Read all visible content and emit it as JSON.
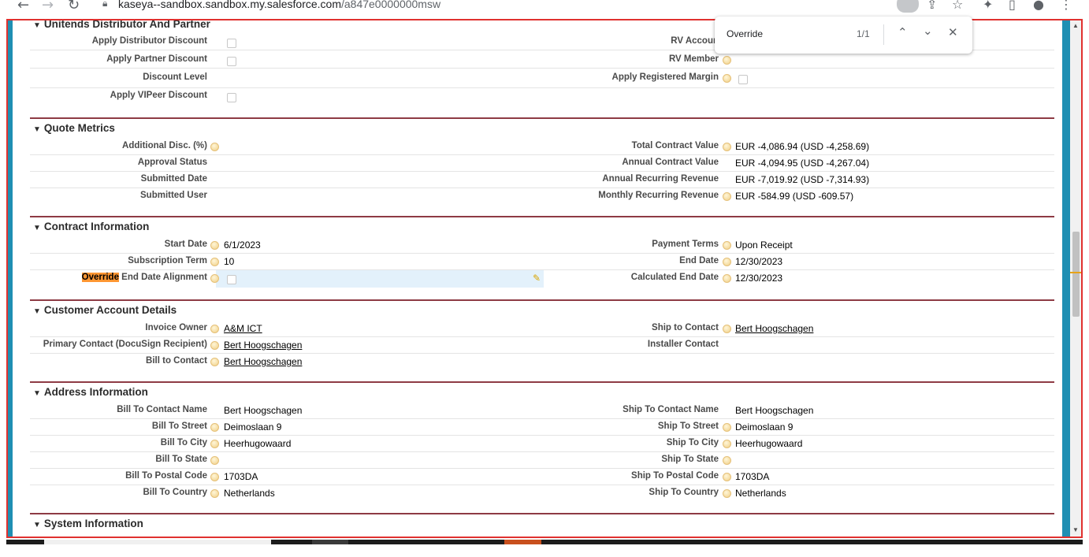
{
  "browser": {
    "url_host": "kaseya--sandbox.sandbox.my.salesforce.com",
    "url_path": "/a847e0000000msw",
    "back_icon": "arrow-left-icon",
    "forward_icon": "arrow-right-icon",
    "reload_icon": "reload-icon",
    "lock_icon": "lock-icon"
  },
  "find_bar": {
    "query": "Override",
    "count": "1/1"
  },
  "sections": {
    "distributor": {
      "title": "Unitends Distributor And Partner",
      "apply_distributor_discount": "Apply Distributor Discount",
      "apply_partner_discount": "Apply Partner Discount",
      "discount_level": "Discount Level",
      "apply_vipeer_discount": "Apply VIPeer Discount",
      "rv_account": "RV Accoun",
      "rv_member": "RV Member",
      "apply_registered_margin": "Apply Registered Margin"
    },
    "quote_metrics": {
      "title": "Quote Metrics",
      "additional_disc": "Additional Disc. (%)",
      "approval_status": "Approval Status",
      "submitted_date": "Submitted Date",
      "submitted_user": "Submitted User",
      "total_contract_value_label": "Total Contract Value",
      "total_contract_value": "EUR -4,086.94 (USD -4,258.69)",
      "annual_contract_value_label": "Annual Contract Value",
      "annual_contract_value": "EUR -4,094.95 (USD -4,267.04)",
      "annual_recurring_revenue_label": "Annual Recurring Revenue",
      "annual_recurring_revenue": "EUR -7,019.92 (USD -7,314.93)",
      "monthly_recurring_revenue_label": "Monthly Recurring Revenue",
      "monthly_recurring_revenue": "EUR -584.99 (USD -609.57)"
    },
    "contract": {
      "title": "Contract Information",
      "start_date_label": "Start Date",
      "start_date": "6/1/2023",
      "subscription_term_label": "Subscription Term",
      "subscription_term": "10",
      "override_hit": "Override",
      "override_rest": " End Date Alignment",
      "payment_terms_label": "Payment Terms",
      "payment_terms": "Upon Receipt",
      "end_date_label": "End Date",
      "end_date": "12/30/2023",
      "calculated_end_date_label": "Calculated End Date",
      "calculated_end_date": "12/30/2023"
    },
    "customer": {
      "title": "Customer Account Details",
      "invoice_owner_label": "Invoice Owner",
      "invoice_owner": "A&M ICT",
      "primary_contact_label": "Primary Contact (DocuSign Recipient)",
      "primary_contact": "Bert Hoogschagen",
      "bill_to_contact_label": "Bill to Contact",
      "bill_to_contact": "Bert Hoogschagen",
      "ship_to_contact_label": "Ship to Contact",
      "ship_to_contact": "Bert Hoogschagen",
      "installer_contact_label": "Installer Contact"
    },
    "address": {
      "title": "Address Information",
      "bill_to_contact_name_label": "Bill To Contact Name",
      "bill_to_contact_name": "Bert Hoogschagen",
      "bill_to_street_label": "Bill To Street",
      "bill_to_street": "Deimoslaan 9",
      "bill_to_city_label": "Bill To City",
      "bill_to_city": "Heerhugowaard",
      "bill_to_state_label": "Bill To State",
      "bill_to_postal_label": "Bill To Postal Code",
      "bill_to_postal": "1703DA",
      "bill_to_country_label": "Bill To Country",
      "bill_to_country": "Netherlands",
      "ship_to_contact_name_label": "Ship To Contact Name",
      "ship_to_contact_name": "Bert Hoogschagen",
      "ship_to_street_label": "Ship To Street",
      "ship_to_street": "Deimoslaan 9",
      "ship_to_city_label": "Ship To City",
      "ship_to_city": "Heerhugowaard",
      "ship_to_state_label": "Ship To State",
      "ship_to_postal_label": "Ship To Postal Code",
      "ship_to_postal": "1703DA",
      "ship_to_country_label": "Ship To Country",
      "ship_to_country": "Netherlands"
    },
    "system": {
      "title": "System Information"
    }
  }
}
